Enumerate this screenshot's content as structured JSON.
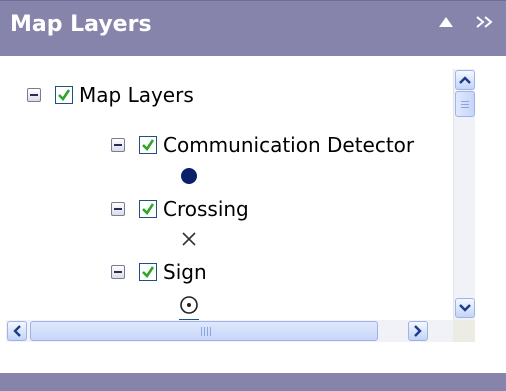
{
  "panel": {
    "title": "Map Layers",
    "collapse_icon": "triangle-up-icon",
    "expand_icon": "double-chevron-right-icon"
  },
  "tree": {
    "root": {
      "label": "Map Layers",
      "checked": true,
      "expanded": true
    },
    "layers": [
      {
        "label": "Communication Detector",
        "checked": true,
        "expanded": true,
        "legend_icon": "filled-circle-icon"
      },
      {
        "label": "Crossing",
        "checked": true,
        "expanded": true,
        "legend_icon": "x-mark-icon"
      },
      {
        "label": "Sign",
        "checked": true,
        "expanded": true,
        "legend_icon": "circle-dot-icon"
      }
    ]
  },
  "colors": {
    "header": "#8684ab",
    "check": "#2aa62a",
    "checkbox_border": "#1c5180",
    "scrollbar": "#c3d4f7",
    "symbol_dot": "#0b1f6b"
  }
}
